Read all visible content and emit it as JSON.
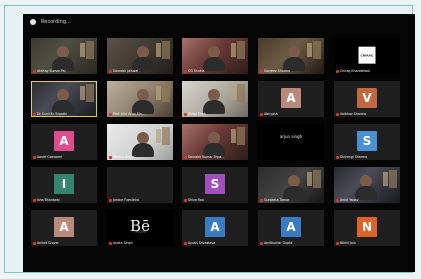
{
  "recording": {
    "label": "Recording..."
  },
  "grid": {
    "rows": [
      [
        {
          "type": "video",
          "style": "cam1",
          "name": "Akshay Kumar Pal"
        },
        {
          "type": "video",
          "style": "cam2",
          "name": "Saurabh Jaiswal"
        },
        {
          "type": "video",
          "style": "cam3",
          "name": "CG Shukla"
        },
        {
          "type": "video",
          "style": "cam4",
          "name": "Sanjeev Sharma"
        },
        {
          "type": "logo",
          "style": "black",
          "name": "Chirag Khandelwal",
          "logo_text": "CHIRAG"
        }
      ],
      [
        {
          "type": "video",
          "style": "cam5",
          "name": "Dr Sunil Kr Tripathi",
          "selected": true
        },
        {
          "type": "video",
          "style": "cam6",
          "name": "Prof. (Dr) Arun Sin..."
        },
        {
          "type": "video",
          "style": "cam7",
          "name": "Shilpi Shah"
        },
        {
          "type": "avatar",
          "letter": "A",
          "color": "#b98a7b",
          "name": "Abhyash"
        },
        {
          "type": "avatar",
          "letter": "V",
          "color": "#c06840",
          "name": "Vaibhav Sharma"
        }
      ],
      [
        {
          "type": "avatar",
          "letter": "A",
          "color": "#df4d8d",
          "name": "Aastri Goswami"
        },
        {
          "type": "video",
          "style": "cam8",
          "name": "Vishnu Gupta"
        },
        {
          "type": "video",
          "style": "cam3",
          "name": "Saurabh Kumar Tripa..."
        },
        {
          "type": "text",
          "style": "black",
          "text": "arjun singh",
          "name": ""
        },
        {
          "type": "avatar",
          "letter": "S",
          "color": "#4a8fd3",
          "name": "Shivangi Sharma"
        }
      ],
      [
        {
          "type": "avatar",
          "letter": "I",
          "color": "#35846d",
          "name": "Isha Bhardwaj"
        },
        {
          "type": "avatar",
          "letter": "",
          "color": "#1f1f1f",
          "name": "Jondur Fuenleira"
        },
        {
          "type": "avatar",
          "letter": "S",
          "color": "#a24fbc",
          "name": "Shiva Rao"
        },
        {
          "type": "video",
          "style": "cam9",
          "name": "Gunjeeta Tomar"
        },
        {
          "type": "video",
          "style": "cam5",
          "name": "Ankit Yadav"
        }
      ],
      [
        {
          "type": "avatar",
          "letter": "A",
          "color": "#b98a7b",
          "name": "Aniket Grover"
        },
        {
          "type": "be",
          "style": "black",
          "text": "Bē",
          "sub": "UNIQUE",
          "name": "Arpita Singh"
        },
        {
          "type": "avatar",
          "letter": "A",
          "color": "#3a7cc3",
          "name": "Ayush Srivastava"
        },
        {
          "type": "avatar",
          "letter": "A",
          "color": "#3a7cc3",
          "name": "Amitkumar Gupta"
        },
        {
          "type": "avatar",
          "letter": "N",
          "color": "#e06228",
          "name": "Nikhil Jain"
        }
      ]
    ]
  }
}
